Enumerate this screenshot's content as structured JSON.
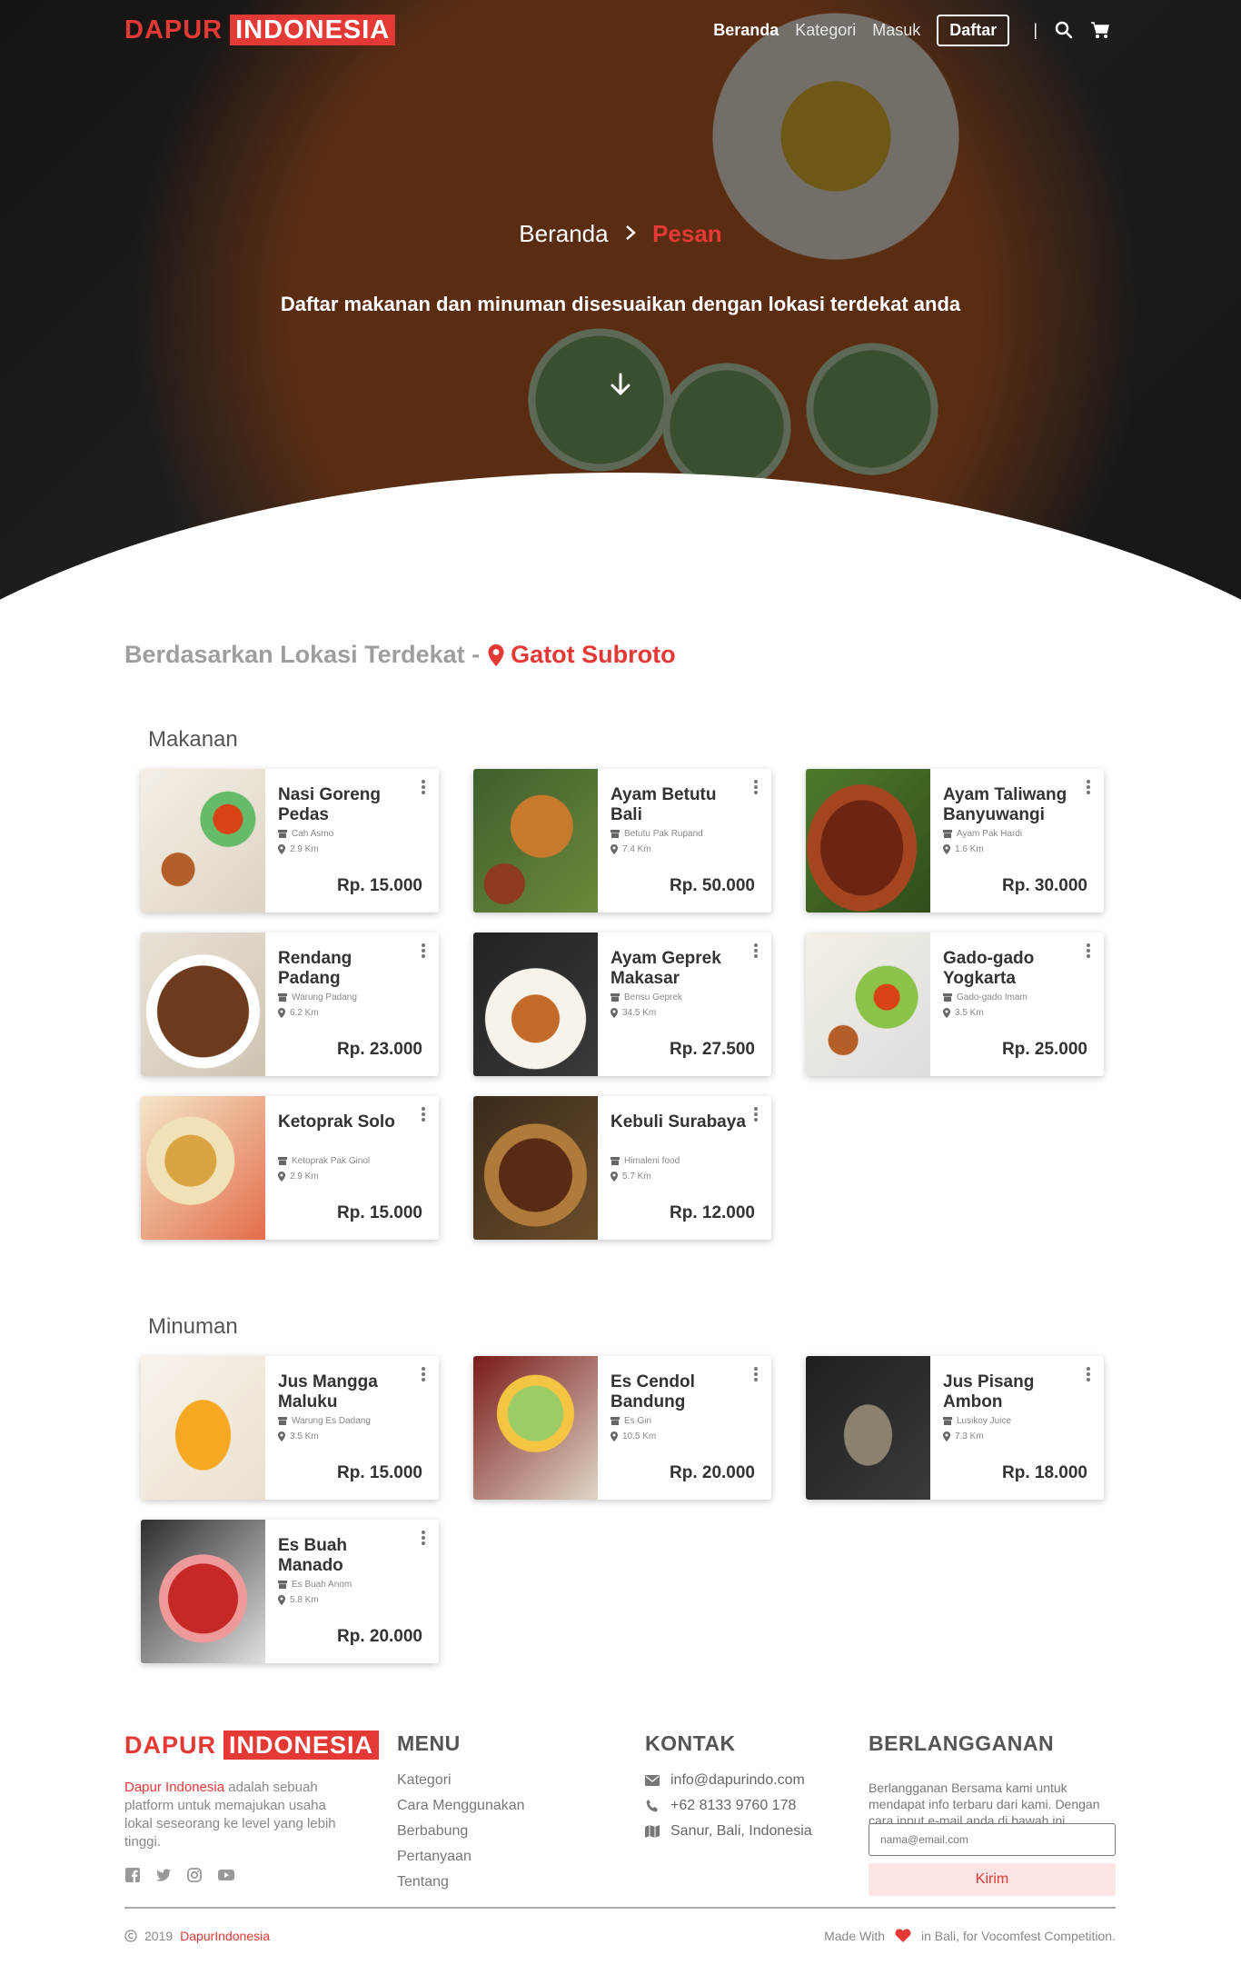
{
  "brand": {
    "part1": "DAPUR",
    "part2": "INDONESIA",
    "color": "#e53935"
  },
  "nav": {
    "items": [
      "Beranda",
      "Kategori",
      "Masuk"
    ],
    "register": "Daftar",
    "separator": "|"
  },
  "hero": {
    "breadcrumb_home": "Beranda",
    "breadcrumb_current": "Pesan",
    "subtitle": "Daftar makanan dan minuman disesuaikan dengan lokasi terdekat anda"
  },
  "location": {
    "label": "Berdasarkan Lokasi Terdekat -",
    "place": "Gatot Subroto"
  },
  "sections": {
    "food": "Makanan",
    "drink": "Minuman"
  },
  "food": [
    {
      "name": "Nasi Goreng Pedas",
      "shop": "Cah Asmo",
      "distance": "2.9 Km",
      "price": "Rp. 15.000"
    },
    {
      "name": "Ayam Betutu Bali",
      "shop": "Betutu Pak Rupand",
      "distance": "7.4 Km",
      "price": "Rp. 50.000"
    },
    {
      "name": "Ayam Taliwang Banyuwangi",
      "shop": "Ayam Pak Hardi",
      "distance": "1.6 Km",
      "price": "Rp. 30.000"
    },
    {
      "name": "Rendang Padang",
      "shop": "Warung Padang",
      "distance": "6.2 Km",
      "price": "Rp. 23.000"
    },
    {
      "name": "Ayam Geprek Makasar",
      "shop": "Bensu Geprek",
      "distance": "34.5 Km",
      "price": "Rp. 27.500"
    },
    {
      "name": "Gado-gado Yogkarta",
      "shop": "Gado-gado Imam",
      "distance": "3.5 Km",
      "price": "Rp. 25.000"
    },
    {
      "name": "Ketoprak Solo",
      "shop": "Ketoprak Pak Ginol",
      "distance": "2.9 Km",
      "price": "Rp. 15.000"
    },
    {
      "name": "Kebuli Surabaya",
      "shop": "Himaleni food",
      "distance": "5.7 Km",
      "price": "Rp. 12.000"
    }
  ],
  "drinks": [
    {
      "name": "Jus Mangga Maluku",
      "shop": "Warung Es Dadang",
      "distance": "3.5 Km",
      "price": "Rp. 15.000"
    },
    {
      "name": "Es Cendol Bandung",
      "shop": "Es Giri",
      "distance": "10.5 Km",
      "price": "Rp. 20.000"
    },
    {
      "name": "Jus Pisang Ambon",
      "shop": "Lusikoy Juice",
      "distance": "7.3 Km",
      "price": "Rp. 18.000"
    },
    {
      "name": "Es Buah Manado",
      "shop": "Es Buah Anom",
      "distance": "5.8 Km",
      "price": "Rp. 20.000"
    }
  ],
  "footer": {
    "desc_brand": "Dapur Indonesia",
    "desc_rest": " adalah sebuah platform untuk memajukan usaha lokal seseorang ke level yang lebih tinggi.",
    "menu_title": "MENU",
    "menu": [
      "Kategori",
      "Cara Menggunakan",
      "Berbabung",
      "Pertanyaan",
      "Tentang"
    ],
    "contact_title": "KONTAK",
    "contact": {
      "email": "info@dapurindo.com",
      "phone": "+62 8133 9760 178",
      "address": "Sanur, Bali, Indonesia"
    },
    "subscribe_title": "BERLANGGANAN",
    "subscribe_text": "Berlangganan Bersama kami untuk mendapat info terbaru dari kami. Dengan cara input e-mail anda di bawah ini.",
    "subscribe_placeholder": "nama@email.com",
    "subscribe_button": "Kirim",
    "copyright_year": "2019",
    "copyright_brand": "DapurIndonesia",
    "made_prefix": "Made With",
    "made_suffix": "in Bali, for Vocomfest Competition."
  },
  "icons": [
    "search-icon",
    "cart-icon",
    "arrow-down-icon",
    "map-pin-icon",
    "store-icon",
    "more-vert-icon",
    "facebook-icon",
    "twitter-icon",
    "instagram-icon",
    "youtube-icon",
    "mail-icon",
    "phone-icon",
    "map-icon",
    "heart-icon",
    "copyright-icon"
  ]
}
